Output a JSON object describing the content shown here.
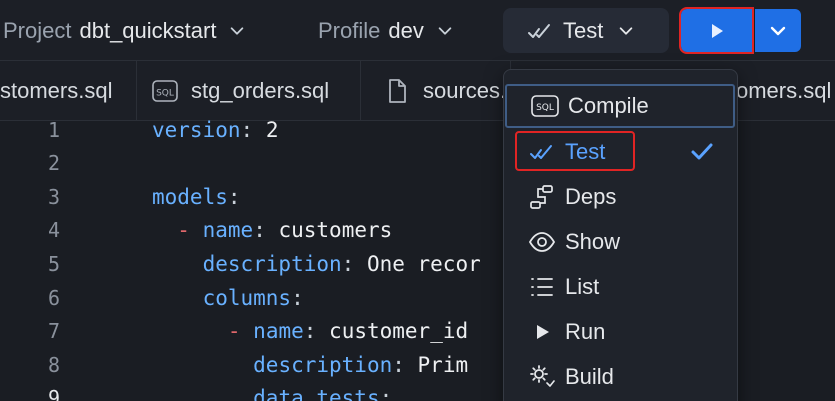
{
  "toolbar": {
    "project_label": "Project",
    "project_value": "dbt_quickstart",
    "profile_label": "Profile",
    "profile_value": "dev",
    "command_label": "Test"
  },
  "tabs": [
    {
      "label": "stomers.sql",
      "icon": "sql-file-icon"
    },
    {
      "label": "stg_orders.sql",
      "icon": "sql-file-icon"
    },
    {
      "label": "sources.",
      "icon": "file-icon"
    },
    {
      "label": "omers.sql",
      "icon": "sql-file-icon"
    }
  ],
  "editor": {
    "lines": [
      {
        "n": "1",
        "parts": [
          {
            "c": "k",
            "t": "version"
          },
          {
            "c": "p",
            "t": ": "
          },
          {
            "c": "v",
            "t": "2"
          }
        ]
      },
      {
        "n": "2",
        "parts": []
      },
      {
        "n": "3",
        "parts": [
          {
            "c": "k",
            "t": "models"
          },
          {
            "c": "p",
            "t": ":"
          }
        ]
      },
      {
        "n": "4",
        "parts": [
          {
            "c": "p",
            "t": "  "
          },
          {
            "c": "d",
            "t": "-"
          },
          {
            "c": "p",
            "t": " "
          },
          {
            "c": "k",
            "t": "name"
          },
          {
            "c": "p",
            "t": ": "
          },
          {
            "c": "v",
            "t": "customers"
          }
        ]
      },
      {
        "n": "5",
        "parts": [
          {
            "c": "p",
            "t": "    "
          },
          {
            "c": "k",
            "t": "description"
          },
          {
            "c": "p",
            "t": ": "
          },
          {
            "c": "v",
            "t": "One recor"
          }
        ]
      },
      {
        "n": "6",
        "parts": [
          {
            "c": "p",
            "t": "    "
          },
          {
            "c": "k",
            "t": "columns"
          },
          {
            "c": "p",
            "t": ":"
          }
        ]
      },
      {
        "n": "7",
        "parts": [
          {
            "c": "p",
            "t": "      "
          },
          {
            "c": "d",
            "t": "-"
          },
          {
            "c": "p",
            "t": " "
          },
          {
            "c": "k",
            "t": "name"
          },
          {
            "c": "p",
            "t": ": "
          },
          {
            "c": "v",
            "t": "customer_id"
          }
        ]
      },
      {
        "n": "8",
        "parts": [
          {
            "c": "p",
            "t": "        "
          },
          {
            "c": "k",
            "t": "description"
          },
          {
            "c": "p",
            "t": ": "
          },
          {
            "c": "v",
            "t": "Prim"
          }
        ]
      },
      {
        "n": "9",
        "parts": [
          {
            "c": "p",
            "t": "        "
          },
          {
            "c": "k",
            "t": "data_tests"
          },
          {
            "c": "p",
            "t": ":"
          }
        ]
      }
    ]
  },
  "menu": {
    "items": [
      {
        "label": "Compile",
        "icon": "sql-icon"
      },
      {
        "label": "Test",
        "icon": "test-check-icon",
        "selected": true
      },
      {
        "label": "Deps",
        "icon": "deps-icon"
      },
      {
        "label": "Show",
        "icon": "eye-icon"
      },
      {
        "label": "List",
        "icon": "list-icon"
      },
      {
        "label": "Run",
        "icon": "play-icon"
      },
      {
        "label": "Build",
        "icon": "build-gear-icon"
      }
    ]
  },
  "colors": {
    "accent": "#1f6fe5",
    "highlight_red": "#e02424",
    "key": "#69b1ff",
    "selected_item": "#5aa2ff"
  }
}
